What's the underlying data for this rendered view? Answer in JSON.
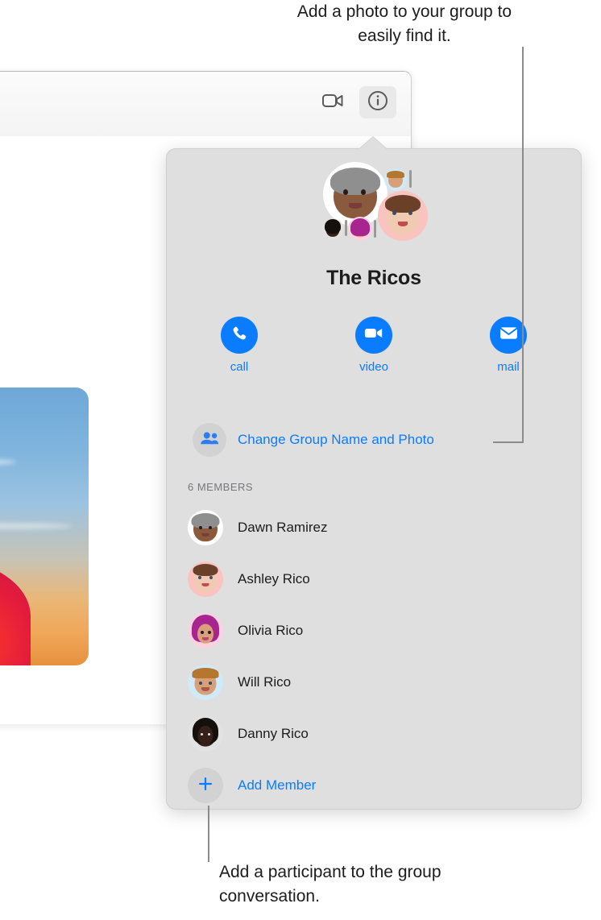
{
  "window": {
    "toolbar": {
      "video_icon": "video-camera-icon",
      "info_icon": "info-circle-icon"
    },
    "attachment_alt": "photo of a person at sunset"
  },
  "popover": {
    "group_title": "The Ricos",
    "actions": [
      {
        "label": "call",
        "icon": "phone-icon"
      },
      {
        "label": "video",
        "icon": "video-camera-icon"
      },
      {
        "label": "mail",
        "icon": "envelope-icon"
      }
    ],
    "change_group": {
      "label": "Change Group Name and Photo",
      "icon": "two-people-icon"
    },
    "members_header": "6 MEMBERS",
    "members": [
      {
        "name": "Dawn Ramirez",
        "avatar_bg": "#ffffff",
        "skin": "#8a5a3c",
        "hair": "#8d8d8d"
      },
      {
        "name": "Ashley Rico",
        "avatar_bg": "#f9c3c0",
        "skin": "#f0cbb2",
        "hair": "#6b4028"
      },
      {
        "name": "Olivia Rico",
        "avatar_bg": "#fbd3e0",
        "skin": "#d9a07e",
        "hair": "#a8248f"
      },
      {
        "name": "Will Rico",
        "avatar_bg": "#cfeaf8",
        "skin": "#d7a078",
        "hair": "#b5762f"
      },
      {
        "name": "Danny Rico",
        "avatar_bg": "#e2e2e2",
        "skin": "#35211a",
        "hair": "#16100d"
      }
    ],
    "add_member": {
      "label": "Add Member",
      "icon": "plus-icon"
    },
    "cluster": [
      {
        "name": "Dawn Ramirez",
        "bg": "#ffffff"
      },
      {
        "name": "Ashley Rico",
        "bg": "#f9c3c0"
      },
      {
        "name": "Will Rico",
        "bg": "#cfeaf8"
      },
      {
        "name": "Olivia Rico",
        "bg": "#fbd3e0"
      },
      {
        "name": "Danny Rico",
        "bg": "#e2e2e2"
      }
    ]
  },
  "callouts": {
    "top": "Add a photo to your group to easily find it.",
    "bottom": "Add a participant to the group conversation."
  },
  "colors": {
    "accent_blue": "#0a7cff",
    "popover_bg": "#dfdfdf",
    "text_primary": "#1c1c1c",
    "text_secondary": "#77777a",
    "callout_line": "#8b8b8b"
  }
}
